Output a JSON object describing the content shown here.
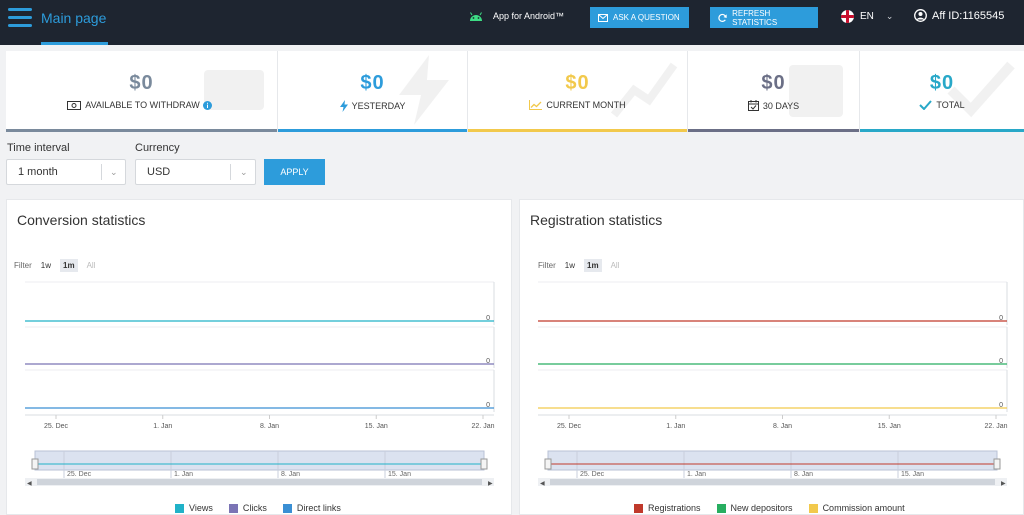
{
  "header": {
    "title": "Main page",
    "android": "App for Android™",
    "ask_question": "ASK A QUESTION",
    "refresh": "REFRESH STATISTICS",
    "lang": "EN",
    "aff_id": "Aff ID:1165545"
  },
  "cards": [
    {
      "amount": "$0",
      "label": "AVAILABLE TO WITHDRAW",
      "icon": "money-icon",
      "color": "#7a8a9c"
    },
    {
      "amount": "$0",
      "label": "YESTERDAY",
      "icon": "lightning-icon",
      "color": "#2d9cdb"
    },
    {
      "amount": "$0",
      "label": "CURRENT MONTH",
      "icon": "chart-icon",
      "color": "#f2c94c"
    },
    {
      "amount": "$0",
      "label": "30 DAYS",
      "icon": "calendar-icon",
      "color": "#6b6f86"
    },
    {
      "amount": "$0",
      "label": "TOTAL",
      "icon": "check-icon",
      "color": "#28a8c8"
    }
  ],
  "filters": {
    "time_label": "Time interval",
    "time_value": "1 month",
    "currency_label": "Currency",
    "currency_value": "USD",
    "apply": "APPLY"
  },
  "conversion": {
    "title": "Conversion statistics",
    "filter_label": "Filter",
    "filter_options": [
      "1w",
      "1m",
      "All"
    ],
    "active_filter": "1m",
    "x_ticks": [
      "25. Dec",
      "1. Jan",
      "8. Jan",
      "15. Jan",
      "22. Jan"
    ],
    "nav_ticks": [
      "25. Dec",
      "1. Jan",
      "8. Jan",
      "15. Jan"
    ],
    "series": [
      {
        "name": "Views",
        "color": "#20b2c8",
        "value": 0
      },
      {
        "name": "Clicks",
        "color": "#7b74b5",
        "value": 0
      },
      {
        "name": "Direct links",
        "color": "#3a8fd4",
        "value": 0
      }
    ]
  },
  "registration": {
    "title": "Registration statistics",
    "filter_label": "Filter",
    "filter_options": [
      "1w",
      "1m",
      "All"
    ],
    "active_filter": "1m",
    "x_ticks": [
      "25. Dec",
      "1. Jan",
      "8. Jan",
      "15. Jan",
      "22. Jan"
    ],
    "nav_ticks": [
      "25. Dec",
      "1. Jan",
      "8. Jan",
      "15. Jan"
    ],
    "series": [
      {
        "name": "Registrations",
        "color": "#c0392b",
        "value": 0
      },
      {
        "name": "New depositors",
        "color": "#27ae60",
        "value": 0
      },
      {
        "name": "Commission amount",
        "color": "#f2c94c",
        "value": 0
      }
    ]
  }
}
